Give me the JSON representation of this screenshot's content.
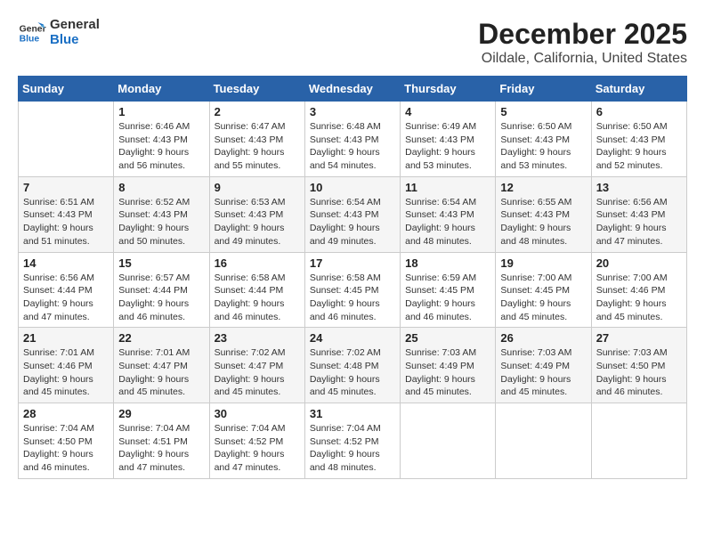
{
  "logo": {
    "line1": "General",
    "line2": "Blue"
  },
  "title": "December 2025",
  "subtitle": "Oildale, California, United States",
  "days_of_week": [
    "Sunday",
    "Monday",
    "Tuesday",
    "Wednesday",
    "Thursday",
    "Friday",
    "Saturday"
  ],
  "weeks": [
    [
      {
        "day": "",
        "info": ""
      },
      {
        "day": "1",
        "info": "Sunrise: 6:46 AM\nSunset: 4:43 PM\nDaylight: 9 hours\nand 56 minutes."
      },
      {
        "day": "2",
        "info": "Sunrise: 6:47 AM\nSunset: 4:43 PM\nDaylight: 9 hours\nand 55 minutes."
      },
      {
        "day": "3",
        "info": "Sunrise: 6:48 AM\nSunset: 4:43 PM\nDaylight: 9 hours\nand 54 minutes."
      },
      {
        "day": "4",
        "info": "Sunrise: 6:49 AM\nSunset: 4:43 PM\nDaylight: 9 hours\nand 53 minutes."
      },
      {
        "day": "5",
        "info": "Sunrise: 6:50 AM\nSunset: 4:43 PM\nDaylight: 9 hours\nand 53 minutes."
      },
      {
        "day": "6",
        "info": "Sunrise: 6:50 AM\nSunset: 4:43 PM\nDaylight: 9 hours\nand 52 minutes."
      }
    ],
    [
      {
        "day": "7",
        "info": "Sunrise: 6:51 AM\nSunset: 4:43 PM\nDaylight: 9 hours\nand 51 minutes."
      },
      {
        "day": "8",
        "info": "Sunrise: 6:52 AM\nSunset: 4:43 PM\nDaylight: 9 hours\nand 50 minutes."
      },
      {
        "day": "9",
        "info": "Sunrise: 6:53 AM\nSunset: 4:43 PM\nDaylight: 9 hours\nand 49 minutes."
      },
      {
        "day": "10",
        "info": "Sunrise: 6:54 AM\nSunset: 4:43 PM\nDaylight: 9 hours\nand 49 minutes."
      },
      {
        "day": "11",
        "info": "Sunrise: 6:54 AM\nSunset: 4:43 PM\nDaylight: 9 hours\nand 48 minutes."
      },
      {
        "day": "12",
        "info": "Sunrise: 6:55 AM\nSunset: 4:43 PM\nDaylight: 9 hours\nand 48 minutes."
      },
      {
        "day": "13",
        "info": "Sunrise: 6:56 AM\nSunset: 4:43 PM\nDaylight: 9 hours\nand 47 minutes."
      }
    ],
    [
      {
        "day": "14",
        "info": "Sunrise: 6:56 AM\nSunset: 4:44 PM\nDaylight: 9 hours\nand 47 minutes."
      },
      {
        "day": "15",
        "info": "Sunrise: 6:57 AM\nSunset: 4:44 PM\nDaylight: 9 hours\nand 46 minutes."
      },
      {
        "day": "16",
        "info": "Sunrise: 6:58 AM\nSunset: 4:44 PM\nDaylight: 9 hours\nand 46 minutes."
      },
      {
        "day": "17",
        "info": "Sunrise: 6:58 AM\nSunset: 4:45 PM\nDaylight: 9 hours\nand 46 minutes."
      },
      {
        "day": "18",
        "info": "Sunrise: 6:59 AM\nSunset: 4:45 PM\nDaylight: 9 hours\nand 46 minutes."
      },
      {
        "day": "19",
        "info": "Sunrise: 7:00 AM\nSunset: 4:45 PM\nDaylight: 9 hours\nand 45 minutes."
      },
      {
        "day": "20",
        "info": "Sunrise: 7:00 AM\nSunset: 4:46 PM\nDaylight: 9 hours\nand 45 minutes."
      }
    ],
    [
      {
        "day": "21",
        "info": "Sunrise: 7:01 AM\nSunset: 4:46 PM\nDaylight: 9 hours\nand 45 minutes."
      },
      {
        "day": "22",
        "info": "Sunrise: 7:01 AM\nSunset: 4:47 PM\nDaylight: 9 hours\nand 45 minutes."
      },
      {
        "day": "23",
        "info": "Sunrise: 7:02 AM\nSunset: 4:47 PM\nDaylight: 9 hours\nand 45 minutes."
      },
      {
        "day": "24",
        "info": "Sunrise: 7:02 AM\nSunset: 4:48 PM\nDaylight: 9 hours\nand 45 minutes."
      },
      {
        "day": "25",
        "info": "Sunrise: 7:03 AM\nSunset: 4:49 PM\nDaylight: 9 hours\nand 45 minutes."
      },
      {
        "day": "26",
        "info": "Sunrise: 7:03 AM\nSunset: 4:49 PM\nDaylight: 9 hours\nand 45 minutes."
      },
      {
        "day": "27",
        "info": "Sunrise: 7:03 AM\nSunset: 4:50 PM\nDaylight: 9 hours\nand 46 minutes."
      }
    ],
    [
      {
        "day": "28",
        "info": "Sunrise: 7:04 AM\nSunset: 4:50 PM\nDaylight: 9 hours\nand 46 minutes."
      },
      {
        "day": "29",
        "info": "Sunrise: 7:04 AM\nSunset: 4:51 PM\nDaylight: 9 hours\nand 47 minutes."
      },
      {
        "day": "30",
        "info": "Sunrise: 7:04 AM\nSunset: 4:52 PM\nDaylight: 9 hours\nand 47 minutes."
      },
      {
        "day": "31",
        "info": "Sunrise: 7:04 AM\nSunset: 4:52 PM\nDaylight: 9 hours\nand 48 minutes."
      },
      {
        "day": "",
        "info": ""
      },
      {
        "day": "",
        "info": ""
      },
      {
        "day": "",
        "info": ""
      }
    ]
  ]
}
